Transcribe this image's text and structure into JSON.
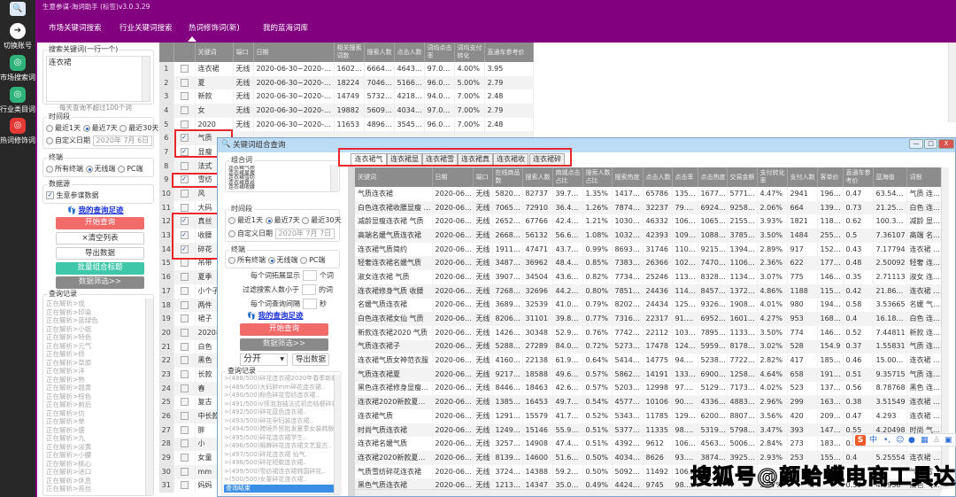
{
  "app": {
    "title": "生意参谋-淘词助手 (标签)v3.0.3.29"
  },
  "sidebar": {
    "items": [
      {
        "label": "切换账号",
        "icon": "switch-account-icon",
        "color": "#282828"
      },
      {
        "label": "市场搜索词",
        "icon": "market-search-icon",
        "color": "#2fb37a"
      },
      {
        "label": "行业类目词",
        "icon": "industry-category-icon",
        "color": "#2fb37a"
      },
      {
        "label": "热词修饰词",
        "icon": "hot-word-icon",
        "color": "#e53935"
      }
    ]
  },
  "nav": {
    "tabs": [
      {
        "label": "市场关键词搜索"
      },
      {
        "label": "行业关键词搜索"
      },
      {
        "label": "热词修饰词(新)",
        "active": true
      },
      {
        "label": "我的蓝海词库"
      }
    ]
  },
  "left": {
    "search_group": "搜索关键词(一行一个)",
    "search_value": "连衣裙",
    "hint": "每天查询不超过100个词",
    "time_group": "时间段",
    "time_options": [
      "最近1天",
      "最近7天",
      "最近30天"
    ],
    "custom_date": "自定义日期",
    "date_value": "2020年 7月 6日",
    "terminal_group": "终端",
    "terminal_options": [
      "所有终端",
      "无线端",
      "PC端"
    ],
    "source_group": "数据源",
    "source_option": "生意参谋数据",
    "history_link": "我的查询足迹",
    "start_btn": "开始查询",
    "clear_btn": "×清空列表",
    "export_btn": "导出数据",
    "batch_btn": "批量组合标题",
    "filter_btn": "数据筛选>>",
    "log_group": "查询记录",
    "log": [
      "正在解析>成",
      "正在解析>印染",
      "正在解析>蓝绿色",
      "正在解析>小姐",
      "正在解析>特色",
      "正在解析>元气",
      "正在解析>修",
      "正在解析>草原",
      "正在解析>洋",
      "正在解析>熟",
      "正在解析>翘黄",
      "正在解析>棕色",
      "正在解析>前后",
      "正在解析>仿",
      "正在解析>单",
      "正在解析>盛",
      "正在解析>九",
      "正在解析>淡黄",
      "正在解析>小腰",
      "正在解析>桃心",
      "正在解析>进口",
      "正在解析>休息",
      "正在解析>亮丝"
    ]
  },
  "main_table": {
    "headers": [
      "",
      "",
      "关键词",
      "端口",
      "日期",
      "相关搜索词数",
      "搜索人数",
      "点击人数",
      "词均点击率",
      "词均支付转化",
      "直通车参考价"
    ],
    "rows": [
      {
        "n": "1",
        "checked": false,
        "cells": [
          "连衣裙",
          "无线",
          "2020-06-30~2020-07-06",
          "160267",
          "666479...",
          "464356...",
          "97.00%",
          "4.00%",
          "3.95"
        ]
      },
      {
        "n": "2",
        "checked": false,
        "cells": [
          "夏",
          "无线",
          "2020-06-30~2020-07-06",
          "18224",
          "7046097",
          "5166281",
          "96.00%",
          "5.00%",
          "2.79"
        ]
      },
      {
        "n": "3",
        "checked": false,
        "cells": [
          "新款",
          "无线",
          "2020-06-30~2020-07-06",
          "14749",
          "5732551",
          "4218503",
          "94.00%",
          "7.00%",
          "2.48"
        ]
      },
      {
        "n": "4",
        "checked": false,
        "cells": [
          "女",
          "无线",
          "2020-06-30~2020-07-06",
          "19882",
          "5609854",
          "4034369",
          "97.00%",
          "7.00%",
          "2.79"
        ]
      },
      {
        "n": "5",
        "checked": false,
        "cells": [
          "2020",
          "无线",
          "2020-06-30~2020-07-06",
          "11653",
          "4896141",
          "3545967",
          "96.00%",
          "7.00%",
          "2.48"
        ]
      },
      {
        "n": "6",
        "checked": true,
        "cells": [
          "气质"
        ]
      },
      {
        "n": "7",
        "checked": true,
        "cells": [
          "显瘦"
        ]
      },
      {
        "n": "8",
        "checked": false,
        "cells": [
          "法式"
        ]
      },
      {
        "n": "9",
        "checked": true,
        "cells": [
          "雪纺"
        ]
      },
      {
        "n": "10",
        "checked": false,
        "cells": [
          "风"
        ]
      },
      {
        "n": "11",
        "checked": false,
        "cells": [
          "大码"
        ]
      },
      {
        "n": "12",
        "checked": true,
        "cells": [
          "真丝"
        ]
      },
      {
        "n": "13",
        "checked": true,
        "cells": [
          "收腰"
        ]
      },
      {
        "n": "14",
        "checked": true,
        "cells": [
          "碎花"
        ]
      },
      {
        "n": "15",
        "checked": false,
        "cells": [
          "吊带"
        ]
      },
      {
        "n": "16",
        "checked": false,
        "cells": [
          "夏季"
        ]
      },
      {
        "n": "17",
        "checked": false,
        "cells": [
          "小个子"
        ]
      },
      {
        "n": "18",
        "checked": false,
        "cells": [
          "两件"
        ]
      },
      {
        "n": "19",
        "checked": false,
        "cells": [
          "裙子"
        ]
      },
      {
        "n": "20",
        "checked": false,
        "cells": [
          "2020年"
        ]
      },
      {
        "n": "21",
        "checked": false,
        "cells": [
          "白色"
        ]
      },
      {
        "n": "22",
        "checked": false,
        "cells": [
          "黑色"
        ]
      },
      {
        "n": "23",
        "checked": false,
        "cells": [
          "长款"
        ]
      },
      {
        "n": "24",
        "checked": false,
        "cells": [
          "春"
        ]
      },
      {
        "n": "25",
        "checked": false,
        "cells": [
          "复古"
        ]
      },
      {
        "n": "26",
        "checked": false,
        "cells": [
          "中长款"
        ]
      },
      {
        "n": "27",
        "checked": false,
        "cells": [
          "胖"
        ]
      },
      {
        "n": "28",
        "checked": false,
        "cells": [
          "小"
        ]
      },
      {
        "n": "29",
        "checked": false,
        "cells": [
          "女童"
        ]
      },
      {
        "n": "30",
        "checked": false,
        "cells": [
          "mm"
        ]
      },
      {
        "n": "31",
        "checked": false,
        "cells": [
          "妈妈"
        ]
      }
    ]
  },
  "dialog": {
    "title": "关键词组合查询",
    "combo_group": "组合词",
    "combo_words": [
      "连衣裙气质",
      "连衣裙显瘦",
      "连衣裙雪纺",
      "连衣裙真丝",
      "连衣裙收腰"
    ],
    "time_group": "时间段",
    "time_options": [
      "最近1天",
      "最近7天",
      "最近30天"
    ],
    "custom_date": "自定义日期",
    "date_value": "2020年 7月 7日",
    "terminal_group": "终端",
    "terminal_options": [
      "所有终端",
      "无线端",
      "PC端"
    ],
    "expand_label": "每个词拓展显示",
    "expand_unit": "个词",
    "filter_label": "过滤搜索人数小于",
    "filter_unit": "的词",
    "interval_label": "每个词查询间隔",
    "interval_unit": "秒",
    "history_link": "我的查询足迹",
    "start_btn": "开始查询",
    "filter_btn": "数据筛选>>",
    "split_select": "分开",
    "export_btn": "导出数据",
    "log_group": "查询记录",
    "log": [
      ">(488/500)碎花连衣裙2020年春季新款小...",
      ">(489/500)大码胖mm碎花连衣裙..",
      ">(490/500)粉色碎花雪纺连衣裙..",
      ">(491/500)v领泡泡袖法式初恋桔梗碎花小...",
      ">(492/500)碎花蓝色连衣裙..",
      ">(493/500)碎花孕妇装连衣裙..",
      ">(494/500)跨境外贸批发夏季女装韩版收...",
      ">(495/500)碎花连衣裙学生..",
      ">(496/500)棉麻碎花连衣裙文艺复古..",
      ">(497/500)碎花连衣裙 仙气..",
      ">(498/500)碎花短款连衣裙..",
      ">(499/500)雪纺裙连衣裙韩国碎花..",
      ">(500/500)女童碎花连衣裙.."
    ],
    "log_selected": "查询结束",
    "tabs": [
      "连衣裙气质",
      "连衣裙显瘦",
      "连衣裙雪纺",
      "连衣裙真丝",
      "连衣裙收腰",
      "连衣裙碎花"
    ],
    "window_buttons": [
      "—",
      "□",
      "X"
    ]
  },
  "result_table": {
    "headers": [
      "关键词",
      "日期",
      "端口",
      "在线商品数",
      "搜索人数",
      "商城点击占比",
      "搜索人数占比",
      "搜索热度",
      "点击人数",
      "点击率",
      "点击热度",
      "交易金额",
      "支付转化率",
      "支付人数",
      "客单价",
      "直通车参考价",
      "蓝海值",
      "词根"
    ],
    "rows": [
      [
        "气质连衣裙",
        "2020-06-3...",
        "无线",
        "582021",
        "82737",
        "39.73%",
        "1.35%",
        "141735...",
        "65786",
        "135.1...",
        "167753...",
        "577141...",
        "4.47%",
        "2941",
        "196.24",
        "0.47",
        "63.54314",
        "气质 连衣裙"
      ],
      [
        "白色连衣裙收腰显瘦 气质",
        "2020-06-3...",
        "无线",
        "706589",
        "72910",
        "36.48%",
        "1.26%",
        "78743...",
        "32237",
        "79.66...",
        "69247...",
        "92584...",
        "2.06%",
        "664",
        "139.43",
        "0.73",
        "21.25629",
        "白色 连衣裙 收..."
      ],
      [
        "减龄显瘦连衣裙 气质",
        "2020-06-3...",
        "无线",
        "265283",
        "67766",
        "42.48%",
        "1.21%",
        "103052...",
        "46332",
        "106.1...",
        "106584...",
        "215580...",
        "3.93%",
        "1821",
        "118.39",
        "0.62",
        "100.39105",
        "减龄 显瘦 连衣..."
      ],
      [
        "高端名媛气质连衣裙",
        "2020-06-3...",
        "无线",
        "2668931",
        "56132",
        "56.63%",
        "1.08%",
        "103260...",
        "42393",
        "109.8...",
        "108862...",
        "378547...",
        "3.50%",
        "1484",
        "255.09",
        "0.5",
        "7.36107",
        "高端 名媛 气质..."
      ],
      [
        "连衣裙气质简约",
        "2020-06-3...",
        "无线",
        "1911288",
        "47471",
        "43.77%",
        "0.99%",
        "86933...",
        "31746",
        "110.9...",
        "92153...",
        "139403...",
        "2.89%",
        "917",
        "152.02",
        "0.43",
        "7.17794",
        "连衣裙 气质 简..."
      ],
      [
        "轻奢连衣裙名媛气质",
        "2020-06-3...",
        "无线",
        "3487923",
        "36962",
        "48.41%",
        "0.85%",
        "73831...",
        "26366",
        "102.1...",
        "74703...",
        "110683...",
        "2.36%",
        "622",
        "177.95",
        "0.48",
        "2.50092",
        "轻奢 连衣裙 名..."
      ],
      [
        "淑女连衣裙 气质",
        "2020-06-3...",
        "无线",
        "3907129",
        "34504",
        "43.67%",
        "0.82%",
        "77347...",
        "25246",
        "113.9...",
        "83280...",
        "113495...",
        "3.07%",
        "775",
        "146.45",
        "0.35",
        "2.71113",
        "淑女 连衣裙 ..."
      ],
      [
        "连衣裙修身气质 收腰",
        "2020-06-3...",
        "无线",
        "726839",
        "32696",
        "44.26%",
        "0.80%",
        "78518...",
        "24436",
        "114.0...",
        "84578...",
        "137229...",
        "4.86%",
        "1188",
        "115.51",
        "0.42",
        "21.86214",
        "连衣裙 修身 气..."
      ],
      [
        "名媛气质连衣裙",
        "2020-06-3...",
        "无线",
        "3689408",
        "32539",
        "41.08%",
        "0.79%",
        "82026...",
        "24434",
        "125.5...",
        "93263...",
        "190823...",
        "4.01%",
        "980",
        "194.72",
        "0.58",
        "3.53665",
        "名媛 气质 连衣..."
      ],
      [
        "白色连衣裙女仙 气质",
        "2020-06-3...",
        "无线",
        "820663",
        "31101",
        "39.80%",
        "0.77%",
        "73161...",
        "22317",
        "91.37...",
        "69523...",
        "160138...",
        "4.27%",
        "953",
        "168.04",
        "0.4",
        "16.18219",
        "白色 连衣裙 女..."
      ],
      [
        "新款连衣裙2020 气质",
        "2020-06-3...",
        "无线",
        "1426106",
        "30348",
        "52.93%",
        "0.76%",
        "77422...",
        "22112",
        "103.5...",
        "78958...",
        "113309...",
        "3.50%",
        "774",
        "146.39",
        "0.52",
        "7.44811",
        "新款 连衣裙 20..."
      ],
      [
        "气质连衣裙子",
        "2020-06-3...",
        "无线",
        "5288592",
        "27289",
        "84.02%",
        "0.72%",
        "52736...",
        "17478",
        "124.0...",
        "59597...",
        "81787...",
        "3.02%",
        "528",
        "154.9",
        "0.37",
        "1.55831",
        "气质 连衣裙 子"
      ],
      [
        "连衣裙气质女神范衣服",
        "2020-06-3...",
        "无线",
        "416080",
        "22138",
        "61.92%",
        "0.64%",
        "54147...",
        "14775",
        "94.34...",
        "52384...",
        "77222.1",
        "2.82%",
        "417",
        "185.18",
        "0.46",
        "15.00412",
        "连衣裙 气质 女..."
      ],
      [
        "气质连衣裙夏",
        "2020-06-3...",
        "无线",
        "921737",
        "18588",
        "49.67%",
        "0.57%",
        "58624...",
        "14191",
        "133.3...",
        "69005...",
        "125821...",
        "4.64%",
        "658",
        "191.22",
        "0.51",
        "9.35715",
        "气质 连衣裙 夏"
      ],
      [
        "黑色连衣裙修身显瘦气质",
        "2020-06-3...",
        "无线",
        "844606",
        "18463",
        "42.61%",
        "0.57%",
        "52031...",
        "12998",
        "97.50...",
        "51290...",
        "71737...",
        "4.02%",
        "523",
        "137.17",
        "0.56",
        "8.78768",
        "黑色 连衣裙 修..."
      ],
      [
        "连衣裙2020新款夏长裙 ...",
        "2020-06-3...",
        "无线",
        "1385323",
        "16453",
        "49.72%",
        "0.54%",
        "45773...",
        "10106",
        "90.95...",
        "43367...",
        "48830...",
        "2.96%",
        "299",
        "163.31",
        "0.38",
        "3.51549",
        "连衣裙 2020 ..."
      ],
      [
        "连衣裙气质",
        "2020-06-3...",
        "无线",
        "1291898",
        "15579",
        "41.77%",
        "0.52%",
        "53438...",
        "11785",
        "129.9...",
        "62009...",
        "88079.2",
        "3.56%",
        "420",
        "209.71",
        "0.47",
        "4.293",
        "连衣裙 气质"
      ],
      [
        "时尚气质连衣裙",
        "2020-06-3...",
        "无线",
        "1249866",
        "15146",
        "55.95%",
        "0.51%",
        "53778...",
        "11335",
        "98.10...",
        "53194...",
        "57987...",
        "3.47%",
        "393",
        "147.55",
        "0.55",
        "4.20498",
        "时尚 气质 连衣..."
      ],
      [
        "连衣裙名媛气质",
        "2020-06-3...",
        "无线",
        "3257256",
        "14908",
        "47.41%",
        "0.51%",
        "43929...",
        "9612",
        "106.9...",
        "45637...",
        "50062...",
        "2.84%",
        "273",
        "183.38",
        "0.58",
        "",
        "连衣裙 名媛 气..."
      ],
      [
        "连衣裙2020新款夏款气质",
        "2020-06-3...",
        "无线",
        "813960",
        "14600",
        "51.61%",
        "0.50%",
        "40342...",
        "8626",
        "93.17...",
        "38747...",
        "39253...",
        "2.93%",
        "253",
        "155.15",
        "0.4",
        "5.25554",
        "连衣裙 2020 ..."
      ],
      [
        "气质雪纺碎花连衣裙",
        "2020-06-3...",
        "无线",
        "3724447",
        "14388",
        "59.20%",
        "0.50%",
        "50921...",
        "11492",
        "106.0...",
        "",
        "",
        "",
        "",
        "",
        "",
        "",
        "气质 雪纺 碎花..."
      ],
      [
        "黑色气质连衣裙",
        "2020-06-3...",
        "无线",
        "1213465",
        "14347",
        "35.07%",
        "0.49%",
        "44245...",
        "9745",
        "98.25...",
        "",
        "",
        "3.97%",
        "",
        "",
        "0.59",
        "4.6938",
        "黑色 气质 连衣..."
      ]
    ]
  },
  "ime": {
    "label": "中"
  },
  "watermark": "搜狐号@颜蛤蟆电商工具达人",
  "colors": {
    "brand": "#820080",
    "accent_red": "#f26b6b",
    "teal": "#3ec7a8",
    "highlight": "#e8262c"
  }
}
